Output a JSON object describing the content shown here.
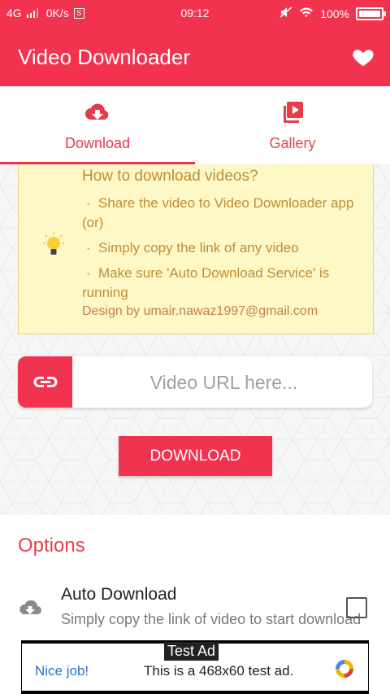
{
  "status_bar": {
    "network": "4G",
    "speed": "0K/s",
    "time": "09:12",
    "battery": "100%",
    "battery_level": 1.0
  },
  "app_bar": {
    "title": "Video Downloader",
    "favorite_icon": "heart-icon"
  },
  "tabs": [
    {
      "label": "Download",
      "icon": "cloud-download-icon",
      "selected": true
    },
    {
      "label": "Gallery",
      "icon": "video-library-icon",
      "selected": false
    }
  ],
  "info_card": {
    "title": "How to download videos?",
    "bullets": [
      "Share the video to Video Downloader app",
      "Simply copy the link of any video",
      "Make sure 'Auto Download Service' is running"
    ],
    "or_text": "(or)",
    "credit": "Design by umair.nawaz1997@gmail.com"
  },
  "url_input": {
    "placeholder": "Video URL here...",
    "value": ""
  },
  "download_button": {
    "label": "DOWNLOAD"
  },
  "options": {
    "heading": "Options",
    "items": [
      {
        "title": "Auto Download",
        "subtitle": "Simply copy the link of video to start download",
        "checked": false
      }
    ]
  },
  "ad": {
    "tag": "Test Ad",
    "left_text": "Nice job!",
    "message": "This is a 468x60 test ad."
  },
  "colors": {
    "accent": "#f2334f",
    "info_bg": "#fdf8c6",
    "info_text": "#c18d36"
  }
}
